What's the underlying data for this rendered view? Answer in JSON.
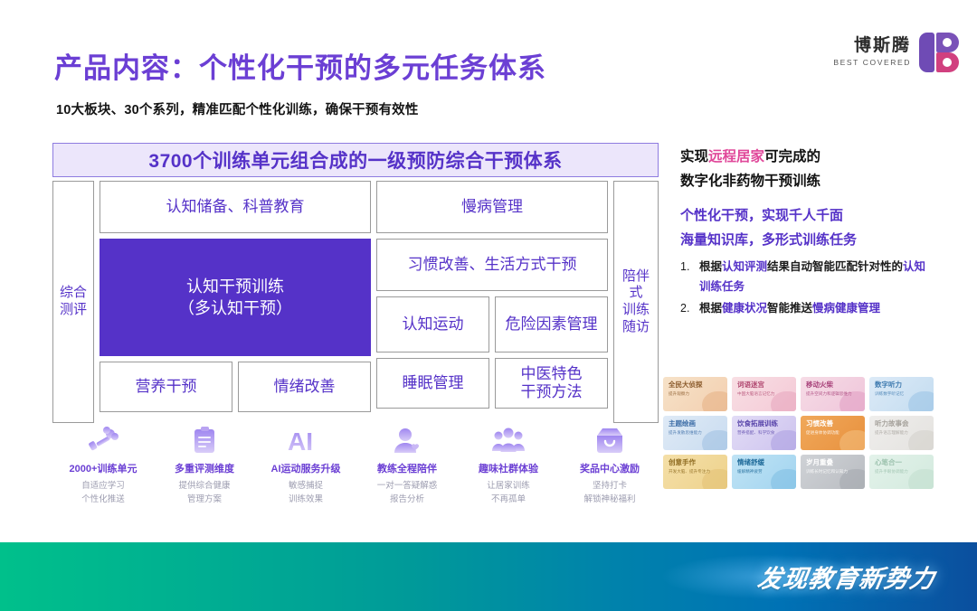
{
  "header": {
    "title": "产品内容：个性化干预的多元任务体系",
    "subtitle": "10大板块、30个系列，精准匹配个性化训练，确保干预有效性",
    "logo_cn": "博斯腾",
    "logo_en": "BEST COVERED"
  },
  "diagram": {
    "banner": "3700个训练单元组合成的一级预防综合干预体系",
    "left_column": "综合\n测评",
    "right_column": "陪伴\n式\n训练\n随访",
    "cells": {
      "top_left": "认知储备、科普教育",
      "main": "认知干预训练\n（多认知干预）",
      "nutrition": "营养干预",
      "emotion": "情绪改善",
      "chronic": "慢病管理",
      "habit": "习惯改善、生活方式干预",
      "exercise": "认知运动",
      "risk": "危险因素管理",
      "sleep": "睡眠管理",
      "tcm": "中医特色\n干预方法"
    }
  },
  "features": [
    {
      "icon": "dumbbell-icon",
      "title": "2000+训练单元",
      "sub1": "自适应学习",
      "sub2": "个性化推送"
    },
    {
      "icon": "clipboard-icon",
      "title": "多重评测维度",
      "sub1": "提供综合健康",
      "sub2": "管理方案"
    },
    {
      "icon": "ai-icon",
      "title": "AI运动服务升级",
      "sub1": "敏感捕捉",
      "sub2": "训练效果"
    },
    {
      "icon": "coach-person-icon",
      "title": "教练全程陪伴",
      "sub1": "一对一答疑解惑",
      "sub2": "报告分析"
    },
    {
      "icon": "community-group-icon",
      "title": "趣味社群体验",
      "sub1": "让居家训练",
      "sub2": "不再孤单"
    },
    {
      "icon": "gift-box-icon",
      "title": "奖品中心激励",
      "sub1": "坚持打卡",
      "sub2": "解锁神秘福利"
    }
  ],
  "right_panel": {
    "head_line1_pre": "实现",
    "head_line1_em": "远程居家",
    "head_line1_post": "可完成的",
    "head_line2": "数字化非药物干预训练",
    "sub_line1": "个性化干预，实现千人千面",
    "sub_line2": "海量知识库，多形式训练任务",
    "items": [
      {
        "num": "1.",
        "parts": [
          {
            "t": "根据",
            "em": false
          },
          {
            "t": "认知评测",
            "em": true
          },
          {
            "t": "结果自动智能匹配针对性的",
            "em": false
          },
          {
            "t": "认知训练任务",
            "em": true
          }
        ]
      },
      {
        "num": "2.",
        "parts": [
          {
            "t": "根据",
            "em": false
          },
          {
            "t": "健康状况",
            "em": true
          },
          {
            "t": "智能推送",
            "em": false
          },
          {
            "t": "慢病健康管理",
            "em": true
          }
        ]
      }
    ]
  },
  "thumbnails": [
    [
      {
        "title": "全民大侦探",
        "sub": "提升观察力",
        "c1": "#f6e2c8",
        "c2": "#f3cfb0",
        "text": "#8a5a2b",
        "blob": "#e2a878"
      },
      {
        "title": "词语迷宫",
        "sub": "中国大脑语言记忆力",
        "c1": "#f8dfe4",
        "c2": "#f4c9d6",
        "text": "#b24a72",
        "blob": "#e59cb6"
      },
      {
        "title": "移动火柴",
        "sub": "提升空间力和逻辑思维力",
        "c1": "#f6dce6",
        "c2": "#efc5da",
        "text": "#a8427a",
        "blob": "#dd92bc"
      },
      {
        "title": "数字听力",
        "sub": "训练数字听记忆",
        "c1": "#dceaf7",
        "c2": "#c3dcf0",
        "text": "#3f7bb0",
        "blob": "#8fbde2"
      }
    ],
    [
      {
        "title": "主题绘画",
        "sub": "提升发散思维能力",
        "c1": "#dfeaf6",
        "c2": "#c9dcf0",
        "text": "#3f6fa8",
        "blob": "#93b9de"
      },
      {
        "title": "饮食拓展训练",
        "sub": "营养搭配、科学饮食",
        "c1": "#e2dcf6",
        "c2": "#cdc3ee",
        "text": "#5a46ab",
        "blob": "#a294dd"
      },
      {
        "title": "习惯改善",
        "sub": "促进身体协调功能",
        "c1": "#f0a85a",
        "c2": "#e8913e",
        "text": "#ffffff",
        "blob": "#f6c98f"
      },
      {
        "title": "听力故事会",
        "sub": "提升语言理解能力",
        "c1": "#efeeec",
        "c2": "#e4e2df",
        "text": "#a6a29c",
        "blob": "#cfcbc5"
      }
    ],
    [
      {
        "title": "创意手作",
        "sub": "开发大脑、提升专注力",
        "c1": "#f4dfa8",
        "c2": "#eed28c",
        "text": "#8d6a1f",
        "blob": "#dfbd6d"
      },
      {
        "title": "情绪舒缓",
        "sub": "缓解精神疲劳",
        "c1": "#bfe3f5",
        "c2": "#a2d4ef",
        "text": "#1e6a99",
        "blob": "#74b9df"
      },
      {
        "title": "岁月重叠",
        "sub": "训练长时记忆和认知力",
        "c1": "#cfd2d6",
        "c2": "#b9bcc1",
        "text": "#ffffff",
        "blob": "#9ea2a8"
      },
      {
        "title": "心笔合一",
        "sub": "提升手眼协调能力",
        "c1": "#e3f2ea",
        "c2": "#d3eade",
        "text": "#9dc2ae",
        "blob": "#bcdcc9"
      }
    ]
  ],
  "footer": {
    "slogan": "发现教育新势力"
  }
}
